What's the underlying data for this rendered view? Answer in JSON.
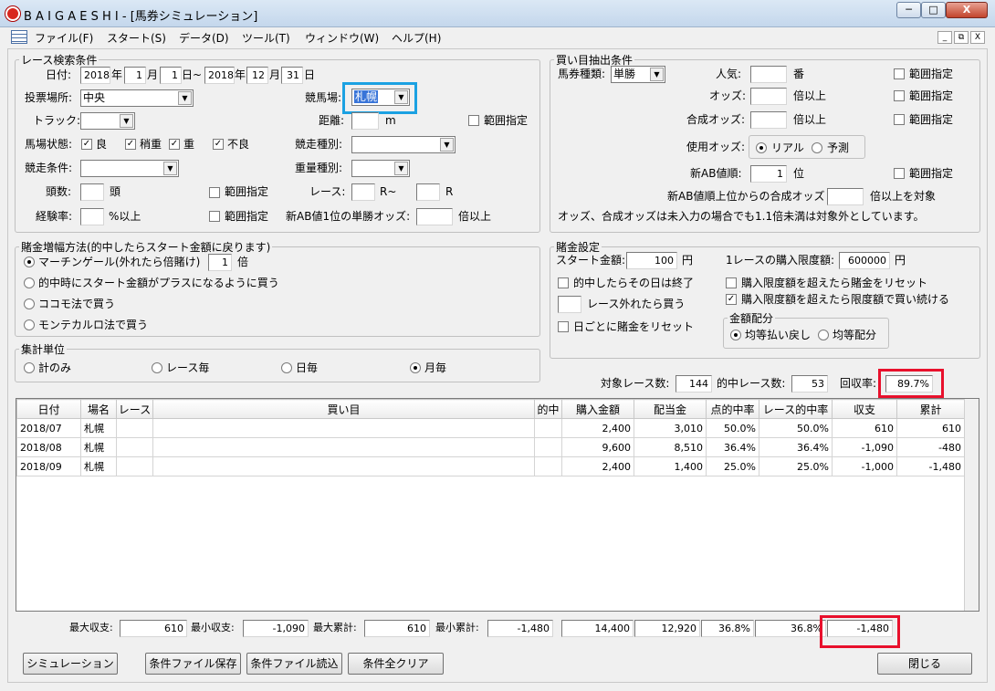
{
  "window": {
    "title": "B A I G A E S H I - [馬券シミュレーション]",
    "min": "─",
    "max": "□",
    "close": "X",
    "mdi_min": "_",
    "mdi_restore": "⧉",
    "mdi_close": "X"
  },
  "menu": [
    "ファイル(F)",
    "スタート(S)",
    "データ(D)",
    "ツール(T)",
    "ウィンドウ(W)",
    "ヘルプ(H)"
  ],
  "race_search": {
    "legend": "レース検索条件",
    "date_label": "日付:",
    "from_year": "2018",
    "year_unit": "年",
    "from_month": "1",
    "month_unit": "月",
    "from_day": "1",
    "tilde_day": "日~",
    "to_year": "2018",
    "to_month": "12",
    "to_day": "31",
    "day_unit": "日",
    "venue_label": "投票場所:",
    "venue_value": "中央",
    "course_label": "競馬場:",
    "course_value": "札幌",
    "track_label": "トラック:",
    "track_value": "",
    "distance_label": "距離:",
    "distance_value": "",
    "distance_unit": "m",
    "range": "範囲指定",
    "condition_label": "馬場状態:",
    "cond": [
      "良",
      "稍重",
      "重",
      "不良"
    ],
    "race_type_label": "競走種別:",
    "race_type_value": "",
    "race_cond_label": "競走条件:",
    "race_cond_value": "",
    "weight_type_label": "重量種別:",
    "weight_type_value": "",
    "heads_label": "頭数:",
    "heads_value": "",
    "heads_unit": "頭",
    "race_label": "レース:",
    "race_from": "",
    "race_tilde": "R~",
    "race_to": "",
    "race_unit": "R",
    "exp_label": "経験率:",
    "exp_value": "",
    "exp_unit": "%以上",
    "ab1_label": "新AB値1位の単勝オッズ:",
    "ab1_value": "",
    "ab1_unit": "倍以上"
  },
  "bet_extract": {
    "legend": "買い目抽出条件",
    "ticket_label": "馬券種類:",
    "ticket_value": "単勝",
    "pop_label": "人気:",
    "pop_value": "",
    "pop_unit": "番",
    "odds_label": "オッズ:",
    "odds_value": "",
    "odds_unit": "倍以上",
    "comb_label": "合成オッズ:",
    "comb_value": "",
    "comb_unit": "倍以上",
    "use_odds_label": "使用オッズ:",
    "real": "リアル",
    "forecast": "予測",
    "ab_rank_label": "新AB値順:",
    "ab_rank_value": "1",
    "ab_rank_unit": "位",
    "ab_top_label": "新AB値順上位からの合成オッズ",
    "ab_top_value": "",
    "ab_top_unit": "倍以上を対象",
    "note": "オッズ、合成オッズは未入力の場合でも1.1倍未満は対象外としています。",
    "range": "範囲指定"
  },
  "increase": {
    "legend": "賭金増幅方法(的中したらスタート金額に戻ります)",
    "opt1": "マーチンゲール(外れたら倍賭け)",
    "opt1_value": "1",
    "opt1_unit": "倍",
    "opt2": "的中時にスタート金額がプラスになるように買う",
    "opt3": "ココモ法で買う",
    "opt4": "モンテカルロ法で買う"
  },
  "aggregate": {
    "legend": "集計単位",
    "opts": [
      "計のみ",
      "レース毎",
      "日毎",
      "月毎"
    ]
  },
  "bet_settings": {
    "legend": "賭金設定",
    "start_label": "スタート金額:",
    "start_value": "100",
    "yen": "円",
    "limit_label": "1レースの購入限度額:",
    "limit_value": "600000",
    "stop_day": "的中したらその日は終了",
    "miss_suffix": "レース外れたら買う",
    "miss_value": "",
    "reset_daily": "日ごとに賭金をリセット",
    "reset_over": "購入限度額を超えたら賭金をリセット",
    "keep_over": "購入限度額を超えたら限度額で買い続ける",
    "alloc_legend": "金額配分",
    "alloc_equal_return": "均等払い戻し",
    "alloc_equal": "均等配分"
  },
  "summary_top": {
    "target_label": "対象レース数:",
    "target_value": "144",
    "hit_label": "的中レース数:",
    "hit_value": "53",
    "recovery_label": "回収率:",
    "recovery_value": "89.7%"
  },
  "table": {
    "headers": [
      "日付",
      "場名",
      "レース",
      "買い目",
      "的中",
      "購入金額",
      "配当金",
      "点的中率",
      "レース的中率",
      "収支",
      "累計"
    ],
    "rows": [
      [
        "2018/07",
        "札幌",
        "",
        "",
        "",
        "2,400",
        "3,010",
        "50.0%",
        "50.0%",
        "610",
        "610"
      ],
      [
        "2018/08",
        "札幌",
        "",
        "",
        "",
        "9,600",
        "8,510",
        "36.4%",
        "36.4%",
        "-1,090",
        "-480"
      ],
      [
        "2018/09",
        "札幌",
        "",
        "",
        "",
        "2,400",
        "1,400",
        "25.0%",
        "25.0%",
        "-1,000",
        "-1,480"
      ]
    ]
  },
  "totals": {
    "max_income_label": "最大収支:",
    "max_income": "610",
    "min_income_label": "最小収支:",
    "min_income": "-1,090",
    "max_cum_label": "最大累計:",
    "max_cum": "610",
    "min_cum_label": "最小累計:",
    "min_cum": "-1,480",
    "purchase": "14,400",
    "payout": "12,920",
    "hit_rate": "36.8%",
    "race_hit_rate": "36.8%",
    "cumulative": "-1,480"
  },
  "buttons": {
    "simulate": "シミュレーション",
    "save": "条件ファイル保存",
    "load": "条件ファイル読込",
    "clear": "条件全クリア",
    "close": "閉じる"
  }
}
